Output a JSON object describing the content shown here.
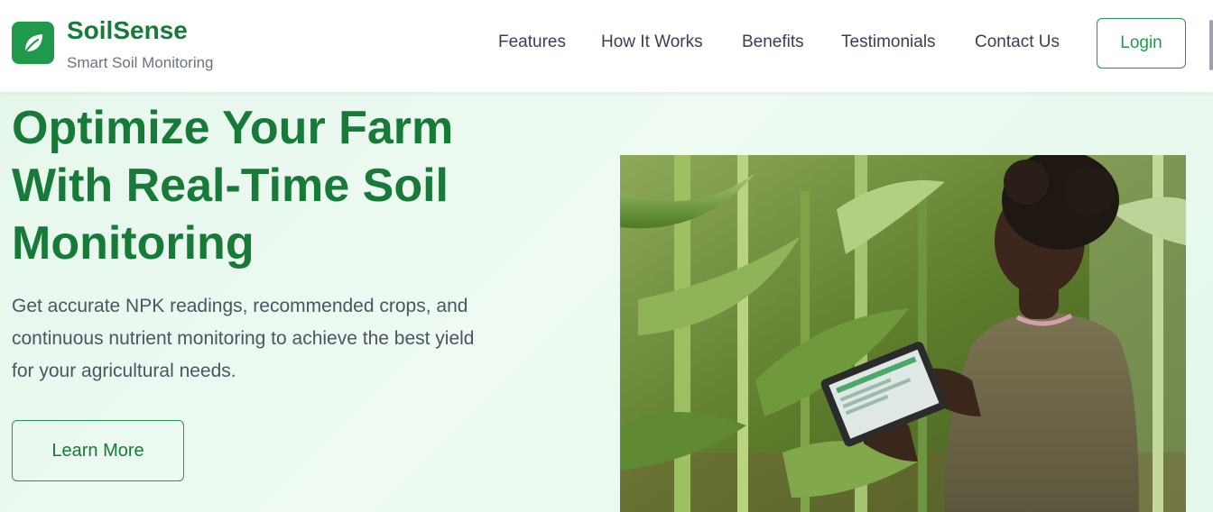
{
  "brand": {
    "name": "SoilSense",
    "tagline": "Smart Soil Monitoring",
    "logo_icon": "leaf-icon",
    "accent_color": "#1f9a4a",
    "title_color": "#177a38"
  },
  "nav": {
    "items": [
      {
        "label": "Features"
      },
      {
        "label": "How It Works"
      },
      {
        "label": "Benefits"
      },
      {
        "label": "Testimonials"
      },
      {
        "label": "Contact Us"
      }
    ],
    "login_label": "Login"
  },
  "hero": {
    "title_lines": [
      "Optimize Your Farm",
      "With Real-Time Soil",
      "Monitoring"
    ],
    "description_lines": [
      "Get accurate NPK readings, recommended crops, and",
      "continuous nutrient monitoring to achieve the best yield",
      "for your agricultural needs."
    ],
    "cta_label": "Learn More",
    "image_subject": "farmer-with-tablet-in-cornfield"
  }
}
